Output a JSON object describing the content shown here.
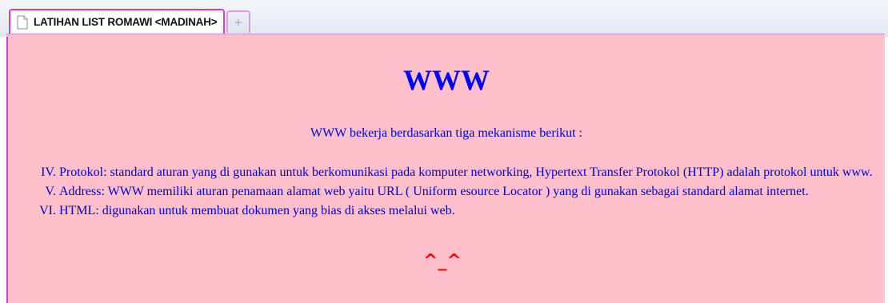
{
  "tab": {
    "title": "LATIHAN LIST ROMAWI <MADINAH>",
    "new_tab_icon": "+"
  },
  "page": {
    "heading": "WWW",
    "intro": "WWW bekerja berdasarkan tiga mekanisme berikut :",
    "items": [
      {
        "numeral": "IV.",
        "text": "Protokol: standard aturan yang di gunakan untuk berkomunikasi pada komputer networking, Hypertext Transfer Protokol (HTTP) adalah protokol untuk www."
      },
      {
        "numeral": "V.",
        "text": "Address: WWW memiliki aturan penamaan alamat web yaitu URL ( Uniform esource Locator ) yang di gunakan sebagai standard alamat internet."
      },
      {
        "numeral": "VI.",
        "text": "HTML: digunakan untuk membuat dokumen yang bias di akses melalui web."
      }
    ],
    "emoticon": "^_^"
  },
  "colors": {
    "background": "#ffc0cb",
    "text": "#0000cc",
    "heading": "#0000ff",
    "emoticon": "#ff0000",
    "tab_border": "#d23cd2"
  }
}
